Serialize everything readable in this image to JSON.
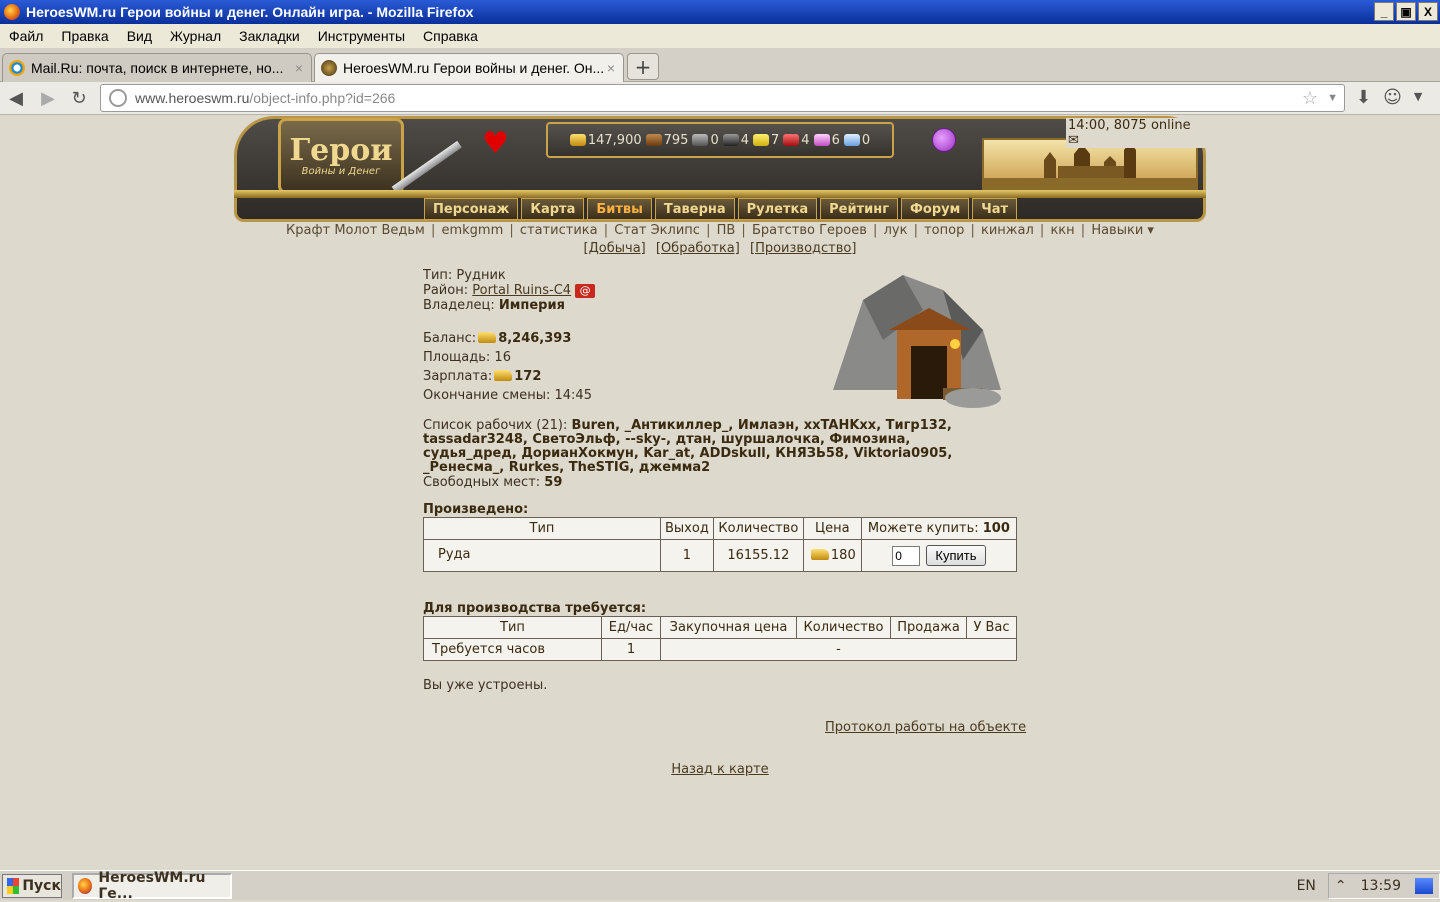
{
  "window": {
    "title": "HeroesWM.ru Герои войны и денег. Онлайн игра. - Mozilla Firefox",
    "buttons": {
      "minimize": "_",
      "maximize": "▣",
      "close": "X"
    }
  },
  "menu": [
    "Файл",
    "Правка",
    "Вид",
    "Журнал",
    "Закладки",
    "Инструменты",
    "Справка"
  ],
  "tabs": [
    {
      "label": "Mail.Ru: почта, поиск в интернете, но...",
      "close": "×",
      "icon": "mailru-icon"
    },
    {
      "label": "HeroesWM.ru Герои войны и денег. Он...",
      "close": "×",
      "icon": "heroes-icon"
    }
  ],
  "new_tab": "+",
  "url": {
    "host": "www.heroeswm.ru",
    "path": "/object-info.php?id=266"
  },
  "header": {
    "logo_big": "Герои",
    "logo_small": "Войны и Денег",
    "resources": [
      "147,900",
      "795",
      "0",
      "4",
      "7",
      "4",
      "6",
      "0"
    ],
    "online": "14:00, 8075 online",
    "nav": [
      "Персонаж",
      "Карта",
      "Битвы",
      "Таверна",
      "Рулетка",
      "Рейтинг",
      "Форум",
      "Чат"
    ]
  },
  "sublinks": [
    "Крафт Молот Ведьм",
    "emkgmm",
    "статистика",
    "Стат Эклипс",
    "ПВ",
    "Братство Героев",
    "лук",
    "топор",
    "кинжал",
    "ккн",
    "Навыки ▾"
  ],
  "sublinks2": [
    "[Добыча]",
    "[Обработка]",
    "[Производство]"
  ],
  "object": {
    "type_label": "Тип:",
    "type_value": "Рудник",
    "district_label": "Район:",
    "district_value": "Portal Ruins-C4",
    "at_symbol": "@",
    "owner_label": "Владелец:",
    "owner_value": "Империя",
    "balance_label": "Баланс:",
    "balance_value": "8,246,393",
    "area_label": "Площадь:",
    "area_value": "16",
    "salary_label": "Зарплата:",
    "salary_value": "172",
    "shift_label": "Окончание смены:",
    "shift_value": "14:45",
    "workers_label": "Список рабочих (21):",
    "workers": "Buren, _Антикиллер_, Имлаэн, xxTAHKxx, Тигр132, tassadar3248, СветоЭльф, --sky-, дтан, шуршалочка, Фимозина, судья_дред, ДорианХокмун, Kar_at, ADDskull, КНЯЗЬ58, Viktoria0905, _Ренесма_, Rurkes, TheSTIG, джемма2",
    "free_label": "Свободных мест:",
    "free_value": "59"
  },
  "produced": {
    "title": "Произведено:",
    "headers": [
      "Тип",
      "Выход",
      "Количество",
      "Цена"
    ],
    "can_buy_label": "Можете купить:",
    "can_buy_value": "100",
    "row": {
      "type": "Руда",
      "output": "1",
      "quantity": "16155.12",
      "price": "180",
      "input_value": "0",
      "buy": "Купить"
    }
  },
  "required": {
    "title": "Для производства требуется:",
    "headers": [
      "Тип",
      "Ед/час",
      "Закупочная цена",
      "Количество",
      "Продажа",
      "У Вас"
    ],
    "row": {
      "type": "Требуется часов",
      "per_hour": "1",
      "rest": "-"
    }
  },
  "message": "Вы уже устроены.",
  "protocol_link": "Протокол работы на объекте",
  "back_link": "Назад к карте",
  "taskbar": {
    "start": "Пуск",
    "task": "HeroesWM.ru Ге...",
    "lang": "EN",
    "tray_arrow": "⌃",
    "clock": "13:59"
  }
}
